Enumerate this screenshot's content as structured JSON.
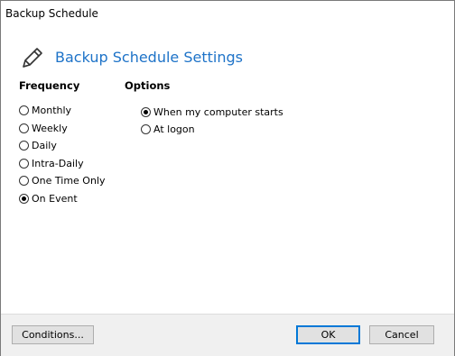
{
  "window": {
    "title": "Backup Schedule"
  },
  "header": {
    "title": "Backup Schedule Settings",
    "icon": "pencil-icon"
  },
  "frequency": {
    "label": "Frequency",
    "options": [
      "Monthly",
      "Weekly",
      "Daily",
      "Intra-Daily",
      "One Time Only",
      "On Event"
    ],
    "selected": "On Event"
  },
  "options": {
    "label": "Options",
    "items": [
      "When my computer starts",
      "At logon"
    ],
    "selected": "When my computer starts"
  },
  "footer": {
    "conditions_label": "Conditions...",
    "ok_label": "OK",
    "cancel_label": "Cancel"
  },
  "colors": {
    "accent": "#1e73c8",
    "default_button_border": "#0078d7"
  }
}
